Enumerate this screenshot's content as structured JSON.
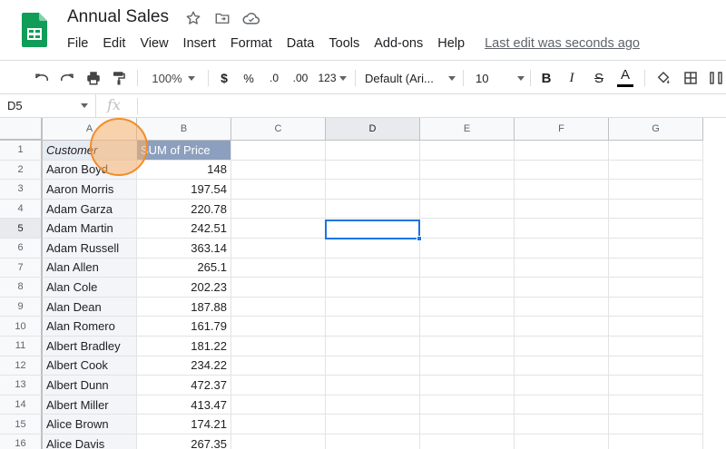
{
  "title": "Annual Sales",
  "menu": [
    "File",
    "Edit",
    "View",
    "Insert",
    "Format",
    "Data",
    "Tools",
    "Add-ons",
    "Help"
  ],
  "last_edit": "Last edit was seconds ago",
  "toolbar": {
    "zoom": "100%",
    "currency": "$",
    "percent": "%",
    "dec_decrease": ".0",
    "dec_increase": ".00",
    "more_formats": "123",
    "font": "Default (Ari...",
    "font_size": "10",
    "bold": "B",
    "italic": "I",
    "strike": "S",
    "text_color": "A"
  },
  "formula_bar": {
    "name_box": "D5",
    "fx": "fx"
  },
  "columns": [
    "A",
    "B",
    "C",
    "D",
    "E",
    "F",
    "G"
  ],
  "rows": [
    "1",
    "2",
    "3",
    "4",
    "5",
    "6",
    "7",
    "8",
    "9",
    "10",
    "11",
    "12",
    "13",
    "14",
    "15",
    "16"
  ],
  "header": {
    "a": "Customer",
    "b": "SUM of Price"
  },
  "data": [
    {
      "name": "Aaron Boyd",
      "value": "148"
    },
    {
      "name": "Aaron Morris",
      "value": "197.54"
    },
    {
      "name": "Adam Garza",
      "value": "220.78"
    },
    {
      "name": "Adam Martin",
      "value": "242.51"
    },
    {
      "name": "Adam Russell",
      "value": "363.14"
    },
    {
      "name": "Alan Allen",
      "value": "265.1"
    },
    {
      "name": "Alan Cole",
      "value": "202.23"
    },
    {
      "name": "Alan Dean",
      "value": "187.88"
    },
    {
      "name": "Alan Romero",
      "value": "161.79"
    },
    {
      "name": "Albert Bradley",
      "value": "181.22"
    },
    {
      "name": "Albert Cook",
      "value": "234.22"
    },
    {
      "name": "Albert Dunn",
      "value": "472.37"
    },
    {
      "name": "Albert Miller",
      "value": "413.47"
    },
    {
      "name": "Alice Brown",
      "value": "174.21"
    },
    {
      "name": "Alice Davis",
      "value": "267.35"
    }
  ],
  "colors": {
    "accent": "#1a73e8",
    "header_b": "#8c9fbe",
    "click": "#f28c28"
  }
}
